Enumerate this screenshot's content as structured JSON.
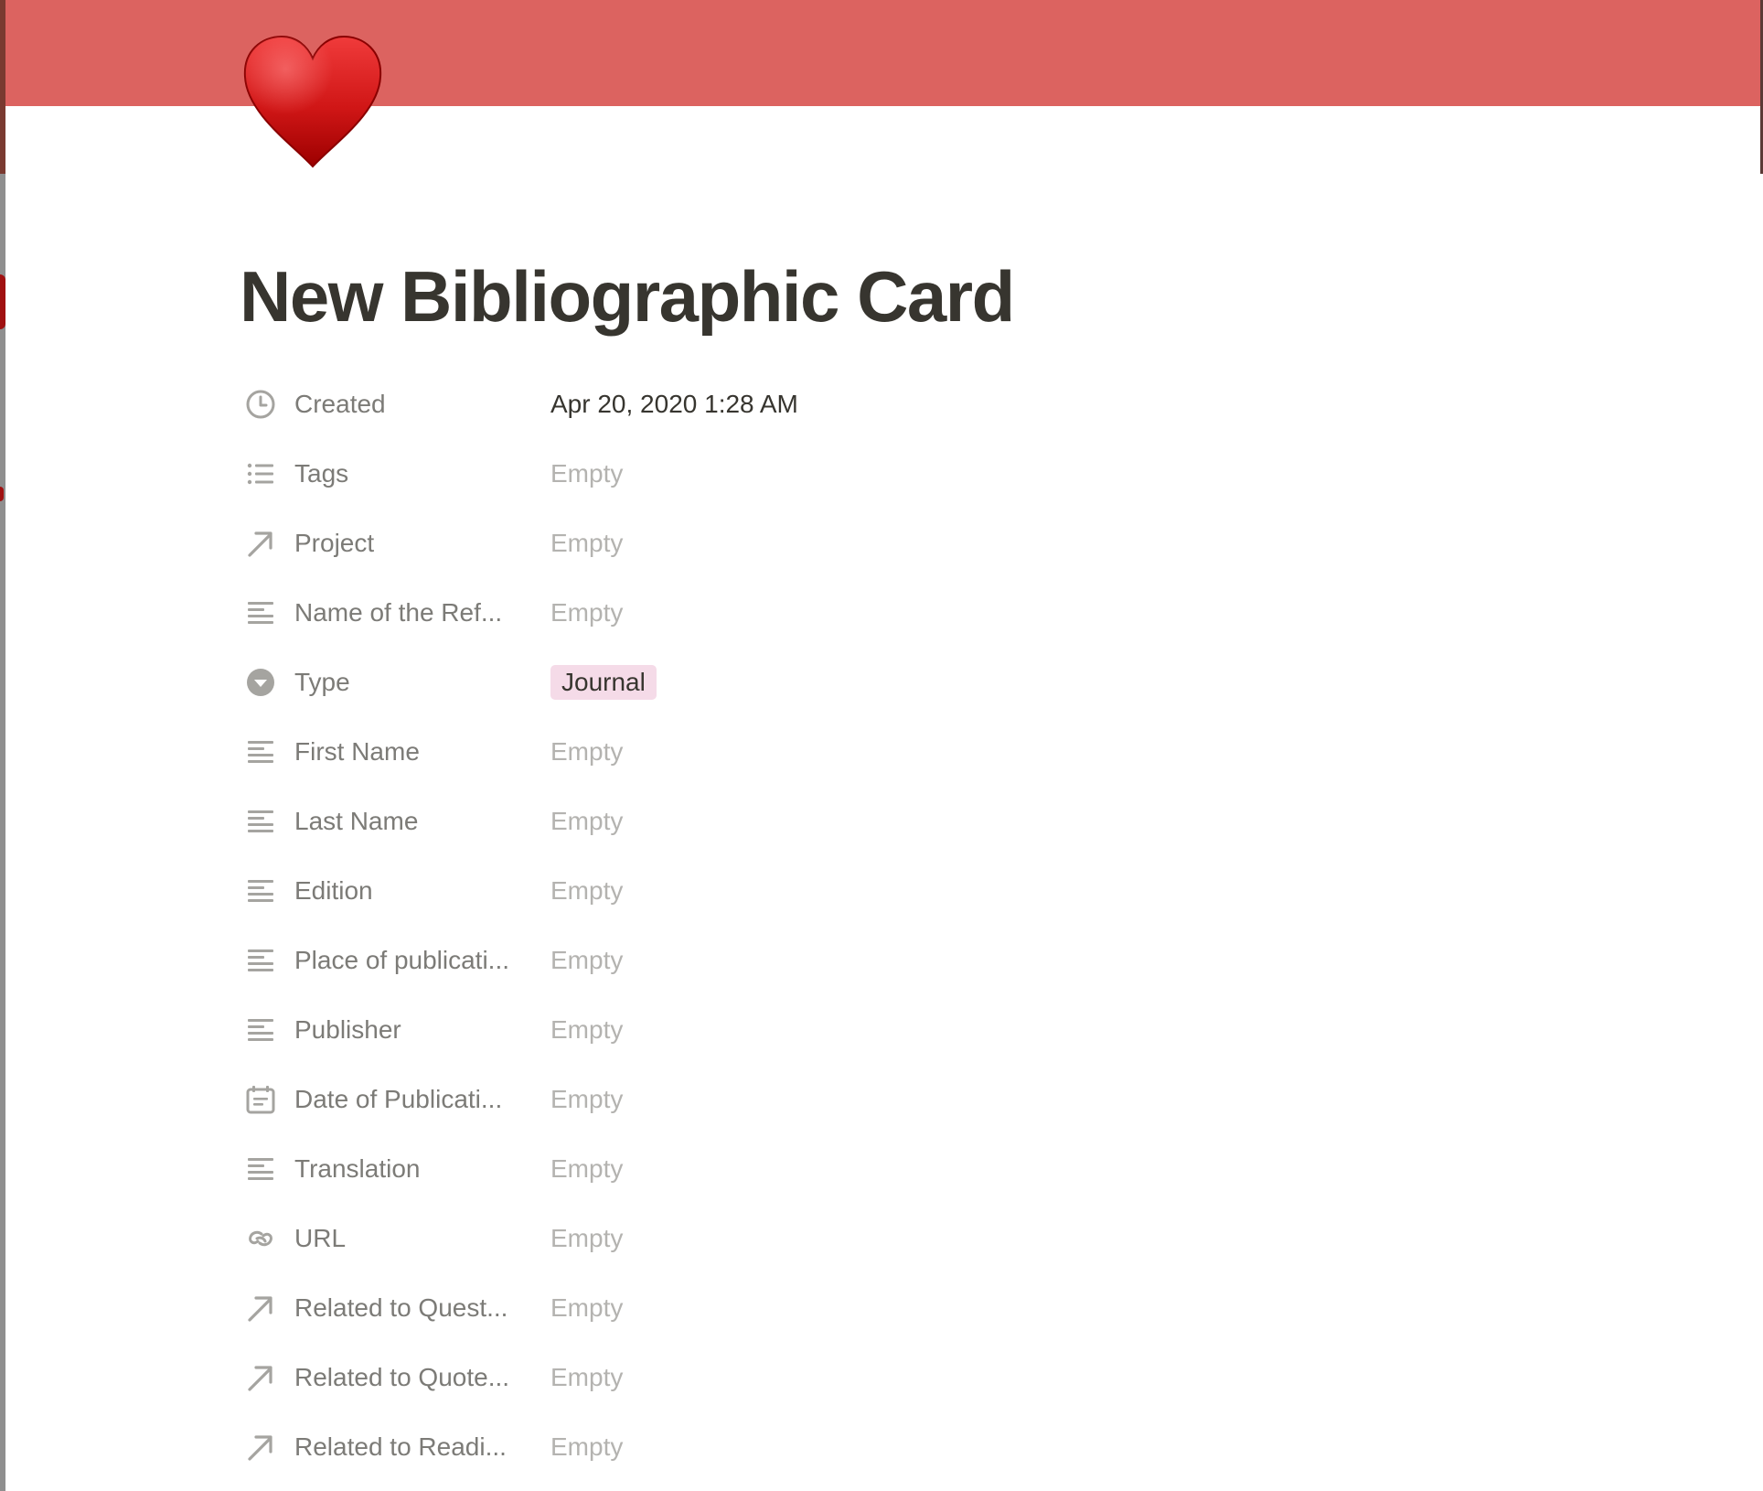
{
  "page": {
    "title": "New Bibliographic Card",
    "icon": "red-heart-emoji",
    "cover_color": "#dc6360"
  },
  "properties": [
    {
      "icon": "clock-icon",
      "label": "Created",
      "value": "Apr 20, 2020 1:28 AM",
      "kind": "filled"
    },
    {
      "icon": "list-icon",
      "label": "Tags",
      "value": "Empty",
      "kind": "empty"
    },
    {
      "icon": "relation-arrow-icon",
      "label": "Project",
      "value": "Empty",
      "kind": "empty"
    },
    {
      "icon": "text-lines-icon",
      "label": "Name of the Ref...",
      "value": "Empty",
      "kind": "empty"
    },
    {
      "icon": "select-icon",
      "label": "Type",
      "value": "Journal",
      "kind": "tag",
      "tag_color": "#f5dbe8"
    },
    {
      "icon": "text-lines-icon",
      "label": "First Name",
      "value": "Empty",
      "kind": "empty"
    },
    {
      "icon": "text-lines-icon",
      "label": "Last Name",
      "value": "Empty",
      "kind": "empty"
    },
    {
      "icon": "text-lines-icon",
      "label": "Edition",
      "value": "Empty",
      "kind": "empty"
    },
    {
      "icon": "text-lines-icon",
      "label": "Place of publicati...",
      "value": "Empty",
      "kind": "empty"
    },
    {
      "icon": "text-lines-icon",
      "label": "Publisher",
      "value": "Empty",
      "kind": "empty"
    },
    {
      "icon": "calendar-icon",
      "label": "Date of Publicati...",
      "value": "Empty",
      "kind": "empty"
    },
    {
      "icon": "text-lines-icon",
      "label": "Translation",
      "value": "Empty",
      "kind": "empty"
    },
    {
      "icon": "link-icon",
      "label": "URL",
      "value": "Empty",
      "kind": "empty"
    },
    {
      "icon": "relation-arrow-icon",
      "label": "Related to Quest...",
      "value": "Empty",
      "kind": "empty"
    },
    {
      "icon": "relation-arrow-icon",
      "label": "Related to Quote...",
      "value": "Empty",
      "kind": "empty"
    },
    {
      "icon": "relation-arrow-icon",
      "label": "Related to Readi...",
      "value": "Empty",
      "kind": "empty"
    }
  ]
}
